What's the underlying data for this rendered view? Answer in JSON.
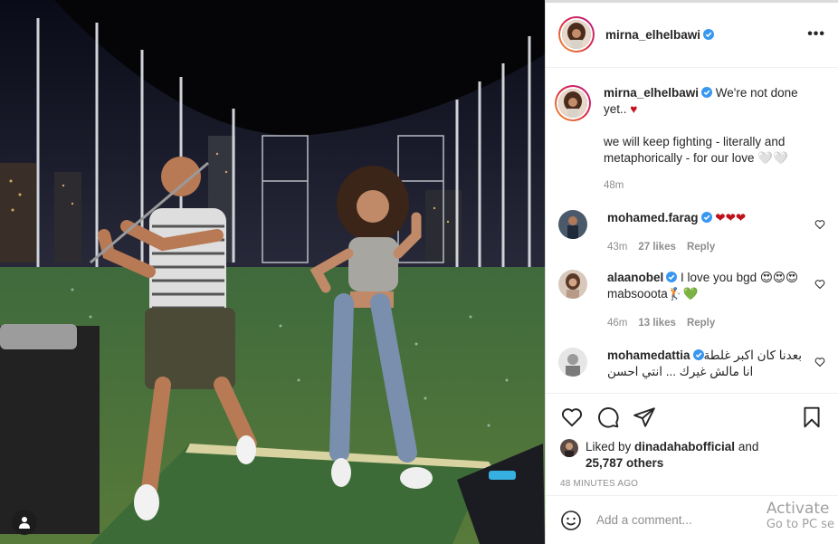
{
  "post": {
    "author": "mirna_elhelbawi",
    "caption_line1": " We're not done yet.. ",
    "caption_line2": "we will keep fighting - literally and metaphorically - for our love 🤍🤍",
    "caption_time": "48m"
  },
  "comments": [
    {
      "user": "mohamed.farag",
      "text": " ❤❤❤",
      "time": "43m",
      "likes": "27 likes",
      "reply": "Reply",
      "avatar_color": "#4a5a6a"
    },
    {
      "user": "alaanobel",
      "text": " I love you bgd 😍😍😍 mabsooota🏌💚",
      "time": "46m",
      "likes": "13 likes",
      "reply": "Reply",
      "avatar_color": "#b89a88"
    },
    {
      "user": "mohamedattia",
      "text": " بعدنا كان اكبر غلطة انا مالش غيرك ... انتي احسن",
      "time": "",
      "likes": "",
      "reply": "",
      "avatar_color": "#cfcfcf"
    }
  ],
  "actions": {
    "liked_by_prefix": "Liked by ",
    "liked_by_user": "dinadahabofficial",
    "liked_by_and": " and",
    "others": "25,787 others",
    "timestamp": "48 MINUTES AGO"
  },
  "add_comment": {
    "placeholder": "Add a comment..."
  },
  "watermark": {
    "line1": "Activate",
    "line2": "Go to PC se"
  },
  "icons": [
    "verified-badge-icon",
    "more-options-icon",
    "heart-icon",
    "comment-icon",
    "share-icon",
    "bookmark-icon",
    "emoji-icon",
    "user-tag-icon"
  ],
  "colors": {
    "verified": "#3897f0",
    "heart_red": "#c0101a",
    "green_heart": "#3cbf4a",
    "link_blue": "#00376b"
  }
}
